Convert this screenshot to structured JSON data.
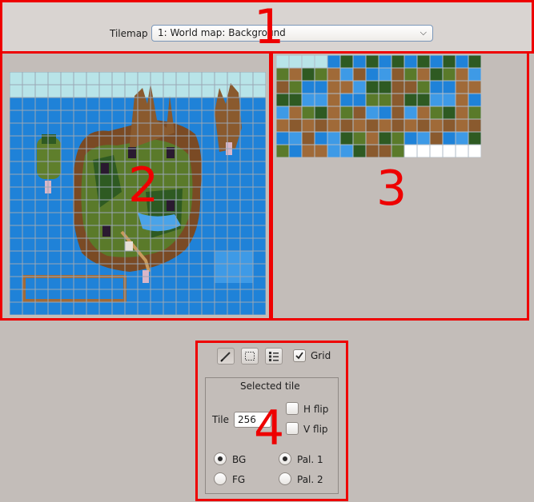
{
  "toolbar": {
    "tilemap_label": "Tilemap",
    "tilemap_value": "1: World map: Background"
  },
  "annotations": {
    "n1": "1",
    "n2": "2",
    "n3": "3",
    "n4": "4"
  },
  "map_view": {
    "grid_visible": true,
    "map_columns": 20,
    "map_rows": 19,
    "grid_cells": 16
  },
  "tileset_view": {
    "columns": 16,
    "rows": 8
  },
  "tools": {
    "items": [
      {
        "name": "pencil-tool",
        "icon": "pencil-icon",
        "active": true
      },
      {
        "name": "rect-select-tool",
        "icon": "rectangle-select-icon",
        "active": false
      },
      {
        "name": "list-tool",
        "icon": "list-icon",
        "active": false
      }
    ],
    "grid_label": "Grid",
    "grid_checked": true
  },
  "selected_tile": {
    "title": "Selected tile",
    "tile_label": "Tile",
    "tile_value": "256",
    "hflip_label": "H flip",
    "vflip_label": "V flip",
    "layer_bg_label": "BG",
    "layer_fg_label": "FG",
    "pal1_label": "Pal. 1",
    "pal2_label": "Pal. 2",
    "layer_selected": "BG",
    "palette_selected": "Pal. 1"
  },
  "colors": {
    "highlight_red": "#ee0000",
    "water": "#1f82d8",
    "grass": "#5a7a2a",
    "mountain": "#8a5a2e",
    "sky": "#b8e4e8"
  }
}
